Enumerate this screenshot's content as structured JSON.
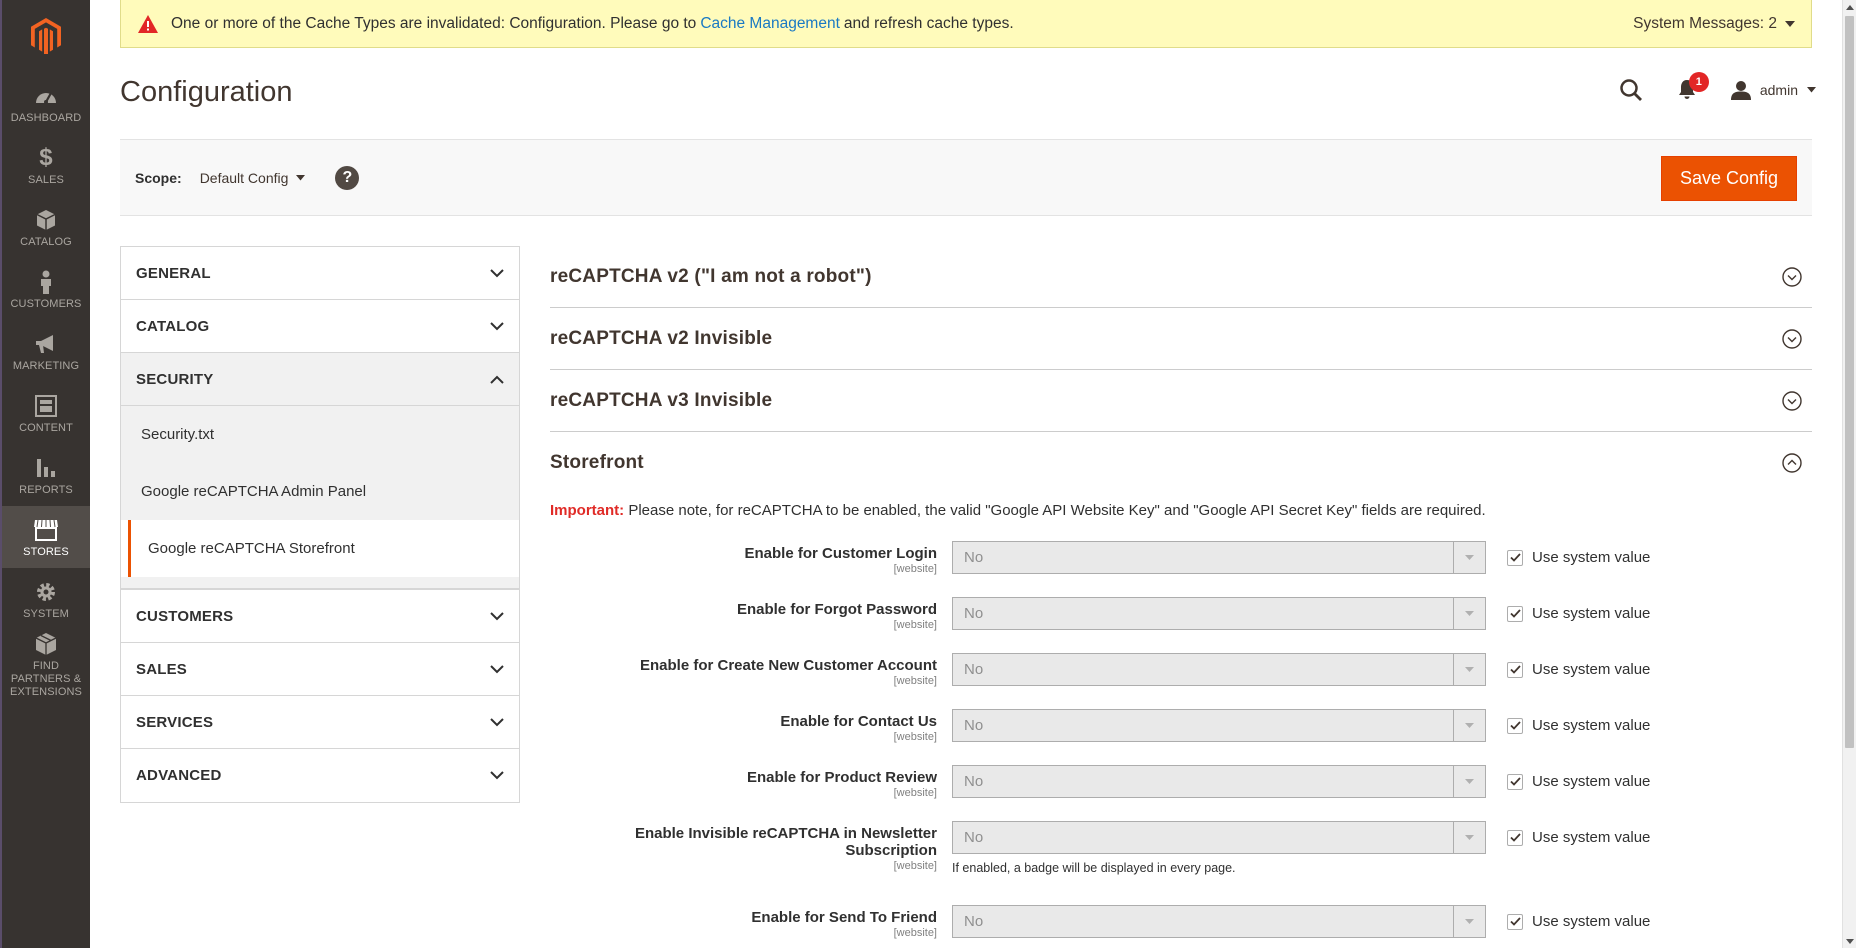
{
  "nav": {
    "items": [
      {
        "label": "Dashboard",
        "icon": "dashboard-icon"
      },
      {
        "label": "Sales",
        "icon": "dollar-icon"
      },
      {
        "label": "Catalog",
        "icon": "cube-icon"
      },
      {
        "label": "Customers",
        "icon": "person-icon"
      },
      {
        "label": "Marketing",
        "icon": "megaphone-icon"
      },
      {
        "label": "Content",
        "icon": "layout-icon"
      },
      {
        "label": "Reports",
        "icon": "bar-chart-icon"
      },
      {
        "label": "Stores",
        "icon": "store-icon"
      },
      {
        "label": "System",
        "icon": "gear-icon"
      },
      {
        "label": "Find Partners & Extensions",
        "icon": "boxes-icon"
      }
    ],
    "active": "Stores"
  },
  "system_message": {
    "text_before": "One or more of the Cache Types are invalidated: Configuration. Please go to",
    "link": "Cache Management",
    "text_after": "and refresh cache types.",
    "count_label": "System Messages: 2"
  },
  "header": {
    "title": "Configuration",
    "notification_count": "1",
    "user": "admin"
  },
  "scope": {
    "label": "Scope:",
    "value": "Default Config",
    "help": "?",
    "save_label": "Save Config"
  },
  "tabs": {
    "general": "GENERAL",
    "catalog": "CATALOG",
    "security": "SECURITY",
    "security_items": [
      "Security.txt",
      "Google reCAPTCHA Admin Panel",
      "Google reCAPTCHA Storefront"
    ],
    "customers": "CUSTOMERS",
    "sales": "SALES",
    "services": "SERVICES",
    "advanced": "ADVANCED"
  },
  "sections": {
    "v2_robot": "reCAPTCHA v2 (\"I am not a robot\")",
    "v2_invisible": "reCAPTCHA v2 Invisible",
    "v3_invisible": "reCAPTCHA v3 Invisible",
    "storefront": "Storefront"
  },
  "important": {
    "label": "Important:",
    "text": "Please note, for reCAPTCHA to be enabled, the valid \"Google API Website Key\" and \"Google API Secret Key\" fields are required."
  },
  "fields": [
    {
      "label": "Enable for Customer Login",
      "scope": "[website]",
      "value": "No",
      "use_system": "Use system value"
    },
    {
      "label": "Enable for Forgot Password",
      "scope": "[website]",
      "value": "No",
      "use_system": "Use system value"
    },
    {
      "label": "Enable for Create New Customer Account",
      "scope": "[website]",
      "value": "No",
      "use_system": "Use system value"
    },
    {
      "label": "Enable for Contact Us",
      "scope": "[website]",
      "value": "No",
      "use_system": "Use system value"
    },
    {
      "label": "Enable for Product Review",
      "scope": "[website]",
      "value": "No",
      "use_system": "Use system value"
    },
    {
      "label": "Enable Invisible reCAPTCHA in Newsletter Subscription",
      "scope": "[website]",
      "value": "No",
      "use_system": "Use system value",
      "note": "If enabled, a badge will be displayed in every page."
    },
    {
      "label": "Enable for Send To Friend",
      "scope": "[website]",
      "value": "No",
      "use_system": "Use system value"
    }
  ],
  "colors": {
    "nav_bg": "#373330",
    "accent": "#eb5202",
    "message_bg": "#fffbbb",
    "link": "#1979c3"
  }
}
